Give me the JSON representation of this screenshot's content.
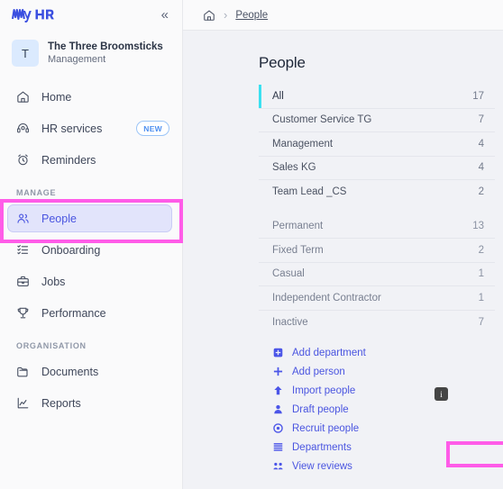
{
  "sidebar": {
    "logo_text": "MyHR",
    "collapse_icon": "chevron-double-left-icon",
    "org": {
      "avatar_initial": "T",
      "name": "The Three Broomsticks",
      "subtitle": "Management"
    },
    "nav": [
      {
        "label": "Home",
        "icon": "home-icon",
        "active": false
      },
      {
        "label": "HR services",
        "icon": "headset-icon",
        "active": false,
        "badge": "NEW"
      },
      {
        "label": "Reminders",
        "icon": "alarm-clock-icon",
        "active": false
      }
    ],
    "sections": [
      {
        "title": "MANAGE",
        "items": [
          {
            "label": "People",
            "icon": "people-icon",
            "active": true
          },
          {
            "label": "Onboarding",
            "icon": "checklist-icon",
            "active": false
          },
          {
            "label": "Jobs",
            "icon": "briefcase-icon",
            "active": false
          },
          {
            "label": "Performance",
            "icon": "trophy-icon",
            "active": false
          }
        ]
      },
      {
        "title": "ORGANISATION",
        "items": [
          {
            "label": "Documents",
            "icon": "folder-icon",
            "active": false
          },
          {
            "label": "Reports",
            "icon": "chart-line-icon",
            "active": false
          }
        ]
      }
    ]
  },
  "breadcrumb": {
    "home_icon": "home-icon",
    "separator": "›",
    "current": "People"
  },
  "main": {
    "page_title": "People",
    "groups": [
      {
        "rows": [
          {
            "label": "All",
            "count": "17",
            "selected": true
          },
          {
            "label": "Customer Service TG",
            "count": "7",
            "selected": false
          },
          {
            "label": "Management",
            "count": "4",
            "selected": false
          },
          {
            "label": "Sales KG",
            "count": "4",
            "selected": false
          },
          {
            "label": "Team Lead _CS",
            "count": "2",
            "selected": false
          }
        ]
      },
      {
        "rows": [
          {
            "label": "Permanent",
            "count": "13",
            "selected": false
          },
          {
            "label": "Fixed Term",
            "count": "2",
            "selected": false
          },
          {
            "label": "Casual",
            "count": "1",
            "selected": false
          },
          {
            "label": "Independent Contractor",
            "count": "1",
            "selected": false
          },
          {
            "label": "Inactive",
            "count": "7",
            "selected": false
          }
        ]
      }
    ],
    "actions": [
      {
        "label": "Add department",
        "icon": "plus-square-icon"
      },
      {
        "label": "Add person",
        "icon": "plus-icon"
      },
      {
        "label": "Import people",
        "icon": "arrow-up-icon"
      },
      {
        "label": "Draft people",
        "icon": "person-icon"
      },
      {
        "label": "Recruit people",
        "icon": "target-icon"
      },
      {
        "label": "Departments",
        "icon": "list-icon"
      },
      {
        "label": "View reviews",
        "icon": "group-icon"
      }
    ],
    "info_chip": "i"
  },
  "annotations": {
    "color": "#ff5ce8",
    "highlighted": [
      "People",
      "Departments"
    ]
  }
}
